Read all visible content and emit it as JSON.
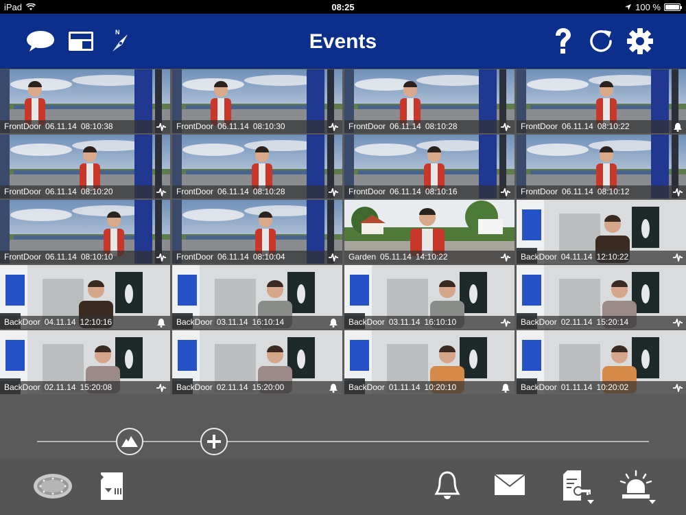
{
  "status_bar": {
    "device": "iPad",
    "time": "08:25",
    "battery": "100 %",
    "battery_level": 1.0
  },
  "header": {
    "title": "Events",
    "left_icons": [
      "chat-bubble-icon",
      "live-view-icon",
      "compass-icon"
    ],
    "right_icons": [
      "help-icon",
      "refresh-icon",
      "settings-icon"
    ]
  },
  "colors": {
    "header_bg": "#0d2f8c",
    "background": "#5a5a5a",
    "caption_bg": "#323232"
  },
  "events": [
    {
      "camera": "FrontDoor",
      "date": "06.11.14",
      "time": "08:10:38",
      "type": "motion",
      "scene": "outdoor"
    },
    {
      "camera": "FrontDoor",
      "date": "06.11.14",
      "time": "08:10:30",
      "type": "motion",
      "scene": "outdoor"
    },
    {
      "camera": "FrontDoor",
      "date": "06.11.14",
      "time": "08:10:28",
      "type": "motion",
      "scene": "outdoor"
    },
    {
      "camera": "FrontDoor",
      "date": "06.11.14",
      "time": "08:10:22",
      "type": "bell",
      "scene": "outdoor"
    },
    {
      "camera": "FrontDoor",
      "date": "06.11.14",
      "time": "08:10:20",
      "type": "motion",
      "scene": "outdoor"
    },
    {
      "camera": "FrontDoor",
      "date": "06.11.14",
      "time": "08:10:28",
      "type": "motion",
      "scene": "outdoor"
    },
    {
      "camera": "FrontDoor",
      "date": "06.11.14",
      "time": "08:10:16",
      "type": "motion",
      "scene": "outdoor"
    },
    {
      "camera": "FrontDoor",
      "date": "06.11.14",
      "time": "08:10:12",
      "type": "motion",
      "scene": "outdoor"
    },
    {
      "camera": "FrontDoor",
      "date": "06.11.14",
      "time": "08:10:10",
      "type": "motion",
      "scene": "outdoor"
    },
    {
      "camera": "FrontDoor",
      "date": "06.11.14",
      "time": "08:10:04",
      "type": "motion",
      "scene": "outdoor"
    },
    {
      "camera": "Garden",
      "date": "05.11.14",
      "time": "14:10:22",
      "type": "motion",
      "scene": "garden"
    },
    {
      "camera": "BackDoor",
      "date": "04.11.14",
      "time": "12:10:22",
      "type": "motion",
      "scene": "indoor"
    },
    {
      "camera": "BackDoor",
      "date": "04.11.14",
      "time": "12:10:16",
      "type": "bell",
      "scene": "indoor"
    },
    {
      "camera": "BackDoor",
      "date": "03.11.14",
      "time": "16:10:14",
      "type": "bell",
      "scene": "indoor"
    },
    {
      "camera": "BackDoor",
      "date": "03.11.14",
      "time": "16:10:10",
      "type": "motion",
      "scene": "indoor"
    },
    {
      "camera": "BackDoor",
      "date": "02.11.14",
      "time": "15:20:14",
      "type": "motion",
      "scene": "indoor"
    },
    {
      "camera": "BackDoor",
      "date": "02.11.14",
      "time": "15:20:08",
      "type": "motion",
      "scene": "indoor"
    },
    {
      "camera": "BackDoor",
      "date": "02.11.14",
      "time": "15:20:00",
      "type": "bell",
      "scene": "indoor"
    },
    {
      "camera": "BackDoor",
      "date": "01.11.14",
      "time": "10:20:10",
      "type": "bell",
      "scene": "indoor"
    },
    {
      "camera": "BackDoor",
      "date": "01.11.14",
      "time": "10:20:02",
      "type": "motion",
      "scene": "indoor"
    }
  ],
  "zoom_slider": {
    "knobs": [
      "landscape-icon",
      "plus-icon"
    ]
  },
  "bottom_bar": {
    "left_icons": [
      "camera-dome-icon",
      "sd-card-icon"
    ],
    "right_icons": [
      "bell-icon",
      "mail-icon",
      "door-key-icon",
      "alarm-light-icon"
    ]
  }
}
